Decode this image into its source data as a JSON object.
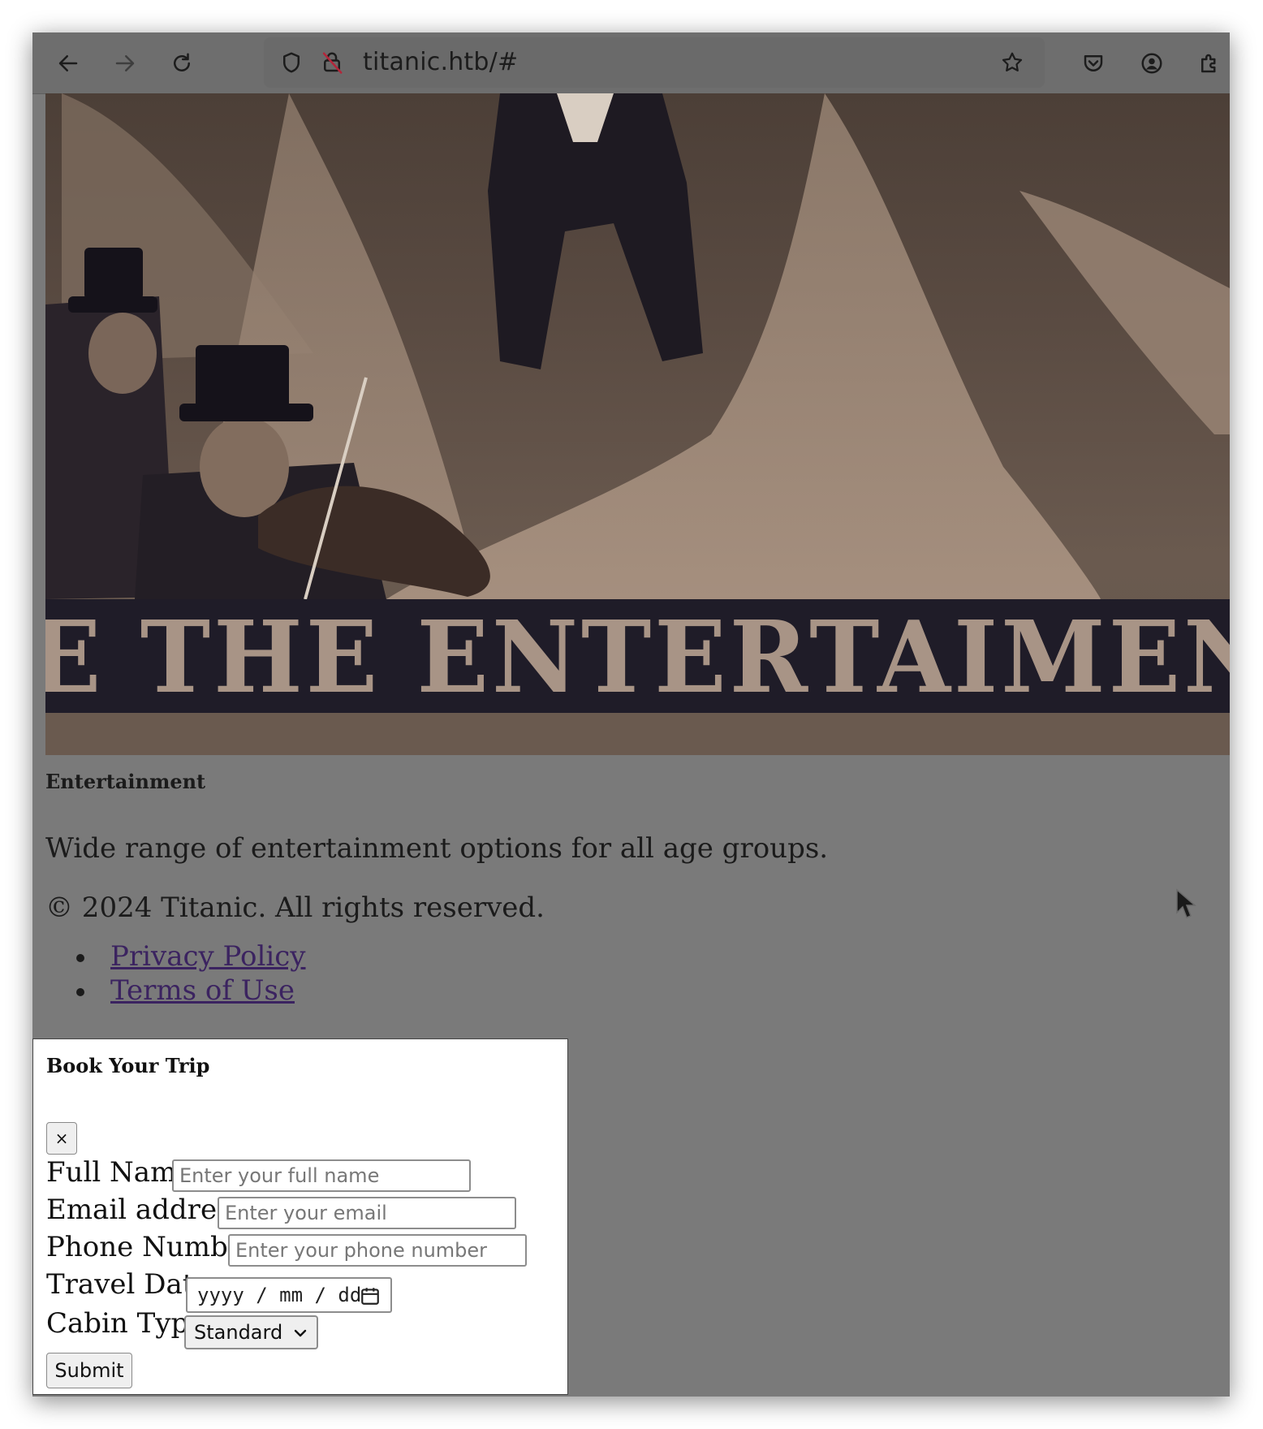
{
  "browser": {
    "url": "titanic.htb/#",
    "icons": [
      "back-arrow-icon",
      "forward-arrow-icon",
      "reload-icon",
      "shield-icon",
      "insecure-lock-icon",
      "bookmark-star-icon",
      "pocket-icon",
      "account-icon",
      "extensions-icon"
    ]
  },
  "hero": {
    "banner_text": "E THE ENTERTAIMENTIEN"
  },
  "content": {
    "heading": "Entertainment",
    "description": "Wide range of entertainment options for all age groups.",
    "copyright": "© 2024 Titanic. All rights reserved.",
    "links": [
      "Privacy Policy",
      "Terms of Use"
    ]
  },
  "modal": {
    "title": "Book Your Trip",
    "close_label": "×",
    "fields": {
      "full_name": {
        "label": "Full Name",
        "placeholder": "Enter your full name"
      },
      "email": {
        "label": "Email address",
        "placeholder": "Enter your email"
      },
      "phone": {
        "label": "Phone Number",
        "placeholder": "Enter your phone number"
      },
      "travel_date": {
        "label": "Travel Date",
        "placeholder": "yyyy / mm / dd"
      },
      "cabin_type": {
        "label": "Cabin Type",
        "value": "Standard"
      }
    },
    "submit_label": "Submit"
  },
  "colors": {
    "overlay": "#7a7a7a",
    "link": "#3b2360",
    "banner": "#1f1c28",
    "banner_text": "#a89486"
  }
}
